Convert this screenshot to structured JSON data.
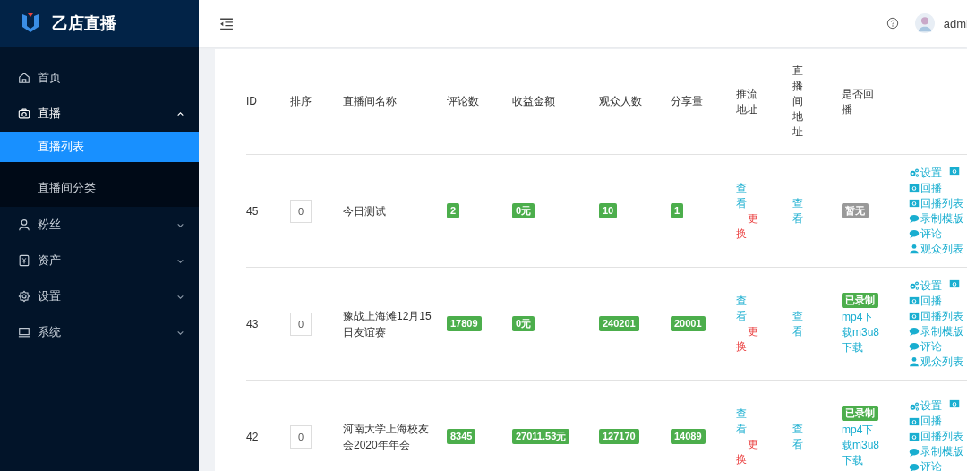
{
  "sidebar": {
    "logo": "乙店直播",
    "items": [
      {
        "kind": "home",
        "label": "首页",
        "expandable": false
      },
      {
        "kind": "camera",
        "label": "直播",
        "expandable": true,
        "expanded": true,
        "children": [
          {
            "label": "直播列表",
            "selected": true
          },
          {
            "label": "直播间分类",
            "selected": false
          }
        ]
      },
      {
        "kind": "user",
        "label": "粉丝",
        "expandable": true,
        "expanded": false
      },
      {
        "kind": "wallet",
        "label": "资产",
        "expandable": true,
        "expanded": false
      },
      {
        "kind": "gear",
        "label": "设置",
        "expandable": true,
        "expanded": false
      },
      {
        "kind": "laptop",
        "label": "系统",
        "expandable": true,
        "expanded": false
      }
    ]
  },
  "header": {
    "user": "admi"
  },
  "table": {
    "columns": [
      "ID",
      "排序",
      "直播间名称",
      "评论数",
      "收益金额",
      "观众人数",
      "分享量",
      "推流地址",
      "直播间地址",
      "是否回播"
    ],
    "rows": [
      {
        "id": "45",
        "sort": "0",
        "name": "今日测试",
        "comments": "2",
        "income": "0元",
        "viewers": "10",
        "shares": "1",
        "push": [
          "查看",
          "更换"
        ],
        "room": "查看",
        "recorded": false,
        "replay_label": "暂无",
        "actions": [
          [
            {
              "kind": "gears",
              "label": "设置"
            },
            {
              "kind": "camera"
            }
          ],
          [
            {
              "kind": "camera",
              "label": "回播"
            }
          ],
          [
            {
              "kind": "camera",
              "label": "回播列表"
            }
          ],
          [
            {
              "kind": "chat",
              "label": "录制模版"
            }
          ],
          [
            {
              "kind": "chat",
              "label": "评论"
            }
          ],
          [
            {
              "kind": "user",
              "label": "观众列表"
            }
          ]
        ]
      },
      {
        "id": "43",
        "sort": "0",
        "name": "豫战上海滩12月15日友谊赛",
        "comments": "17809",
        "income": "0元",
        "viewers": "240201",
        "shares": "20001",
        "push": [
          "查看",
          "更换"
        ],
        "room": "查看",
        "recorded": true,
        "replay_label": "已录制",
        "download": "mp4下载m3u8下载",
        "actions": [
          [
            {
              "kind": "gears",
              "label": "设置"
            },
            {
              "kind": "camera"
            }
          ],
          [
            {
              "kind": "camera",
              "label": "回播"
            }
          ],
          [
            {
              "kind": "camera",
              "label": "回播列表"
            }
          ],
          [
            {
              "kind": "chat",
              "label": "录制模版"
            }
          ],
          [
            {
              "kind": "chat",
              "label": "评论"
            }
          ],
          [
            {
              "kind": "user",
              "label": "观众列表"
            }
          ]
        ]
      },
      {
        "id": "42",
        "sort": "0",
        "name": "河南大学上海校友会2020年年会",
        "comments": "8345",
        "income": "27011.53元",
        "viewers": "127170",
        "shares": "14089",
        "push": [
          "查看",
          "更换"
        ],
        "room": "查看",
        "recorded": true,
        "replay_label": "已录制",
        "download": "mp4下载m3u8下载",
        "actions": [
          [
            {
              "kind": "gears",
              "label": "设置"
            },
            {
              "kind": "camera"
            }
          ],
          [
            {
              "kind": "camera",
              "label": "回播"
            }
          ],
          [
            {
              "kind": "camera",
              "label": "回播列表"
            }
          ],
          [
            {
              "kind": "chat",
              "label": "录制模版"
            }
          ],
          [
            {
              "kind": "chat",
              "label": "评论"
            }
          ]
        ]
      }
    ]
  }
}
